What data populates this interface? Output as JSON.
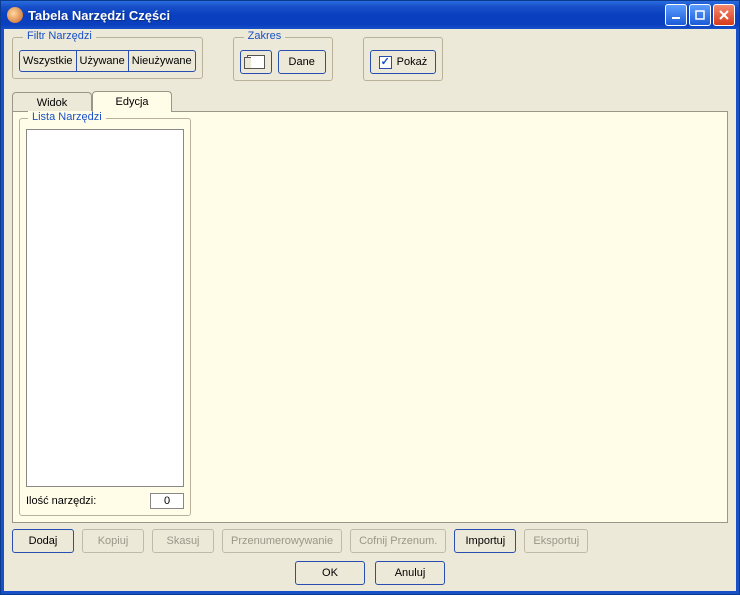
{
  "title": "Tabela Narzędzi Części",
  "filter": {
    "legend": "Filtr Narzędzi",
    "all": "Wszystkie",
    "used": "Używane",
    "unused": "Nieużywane"
  },
  "range": {
    "legend": "Zakres",
    "data": "Dane"
  },
  "show": {
    "label": "Pokaż",
    "checked": true
  },
  "tabs": {
    "view": "Widok",
    "edit": "Edycja",
    "active": "edit"
  },
  "list": {
    "legend": "Lista  Narzędzi",
    "count_label": "Ilość narzędzi:",
    "count_value": "0"
  },
  "buttons": {
    "add": "Dodaj",
    "copy": "Kopiuj",
    "delete": "Skasuj",
    "renumber": "Przenumerowywanie",
    "undo_renumber": "Cofnij Przenum.",
    "import": "Importuj",
    "export": "Eksportuj",
    "ok": "OK",
    "cancel": "Anuluj"
  }
}
